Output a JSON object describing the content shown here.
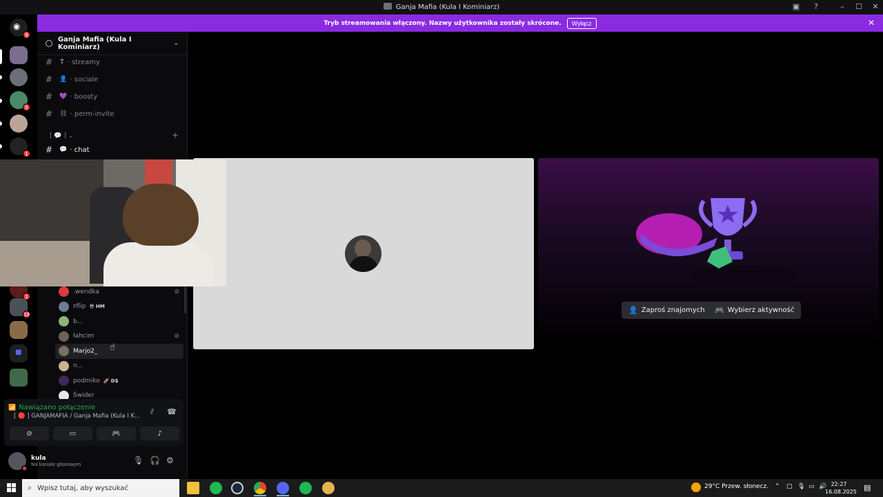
{
  "window": {
    "title": "Ganja Mafia (Kula I Kominiarz)"
  },
  "banner": {
    "text": "Tryb streamowania włączony. Nazwy użytkownika zostały skrócone.",
    "button": "Wyłącz"
  },
  "server": {
    "name": "Ganja Mafia (Kula I Kominiarz)"
  },
  "rail_badges": [
    "9",
    "5",
    "1",
    "1",
    "19"
  ],
  "channels": [
    {
      "label": "· streamy",
      "emoji": "❣"
    },
    {
      "label": "· sociale",
      "emoji": "👤"
    },
    {
      "label": "· boosty",
      "emoji": "💜"
    },
    {
      "label": "· perm-invite",
      "emoji": "⛓"
    }
  ],
  "category": "[ 💬 ]",
  "active_channel": {
    "label": "· chat",
    "emoji": "💬"
  },
  "voice_users": [
    {
      "name": ".wendka",
      "tag": "",
      "muted": true
    },
    {
      "name": "ꜰflip",
      "tag": "😎 HM",
      "muted": false
    },
    {
      "name": "b...",
      "tag": "",
      "muted": false
    },
    {
      "name": "łahcim",
      "tag": "",
      "muted": true
    },
    {
      "name": "Marjo2_",
      "tag": "",
      "muted": false
    },
    {
      "name": "n...",
      "tag": "",
      "muted": false
    },
    {
      "name": "podmiko",
      "tag": "🚀 D$",
      "muted": false
    },
    {
      "name": "Świder",
      "tag": "",
      "muted": false
    }
  ],
  "voice_panel": {
    "status": "Nawiązano połączenie",
    "channel": "[ 🔴 ] GANJAMAFIA / Ganja Mafia (Kula I K..."
  },
  "user": {
    "name": "kula",
    "status": "Na kanale głosowym"
  },
  "activity": {
    "invite": "Zaproś znajomych",
    "choose": "Wybierz aktywność"
  },
  "taskbar": {
    "search_placeholder": "Wpisz tutaj, aby wyszukać",
    "weather": "29°C  Przew. słonecz.",
    "time": "22:27",
    "date": "16.08.2025"
  },
  "colors": {
    "banner": "#8a2be2",
    "connected": "#23a55a",
    "badge": "#f23f43"
  }
}
